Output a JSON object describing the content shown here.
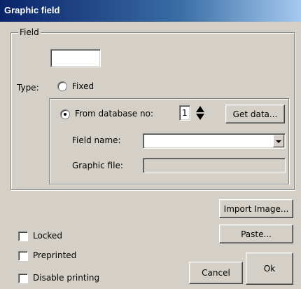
{
  "window": {
    "title": "Graphic field"
  },
  "field_group": {
    "legend": "Field",
    "field_value": ""
  },
  "type": {
    "label": "Type:",
    "fixed_label": "Fixed",
    "from_db_label": "From database no:",
    "db_number": "1",
    "get_data_label": "Get data...",
    "field_name_label": "Field name:",
    "field_name_value": "",
    "graphic_file_label": "Graphic file:",
    "graphic_file_value": ""
  },
  "buttons": {
    "import_image": "Import Image...",
    "paste": "Paste...",
    "cancel": "Cancel",
    "ok": "Ok"
  },
  "options": {
    "locked": "Locked",
    "preprinted": "Preprinted",
    "disable_printing": "Disable printing"
  }
}
